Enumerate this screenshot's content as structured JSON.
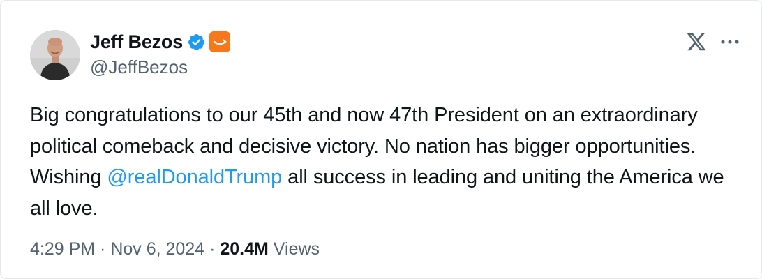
{
  "author": {
    "display_name": "Jeff Bezos",
    "handle": "@JeffBezos",
    "verified": true,
    "affiliate_badge": "amazon-smile-badge"
  },
  "tweet": {
    "text_before_mention": "Big congratulations to our 45th and now 47th President on an extraordinary political comeback and decisive victory. No nation has bigger opportunities. Wishing ",
    "mention": "@realDonaldTrump",
    "text_after_mention": " all success in leading and uniting the America we all love."
  },
  "meta": {
    "time": "4:29 PM",
    "separator1": " · ",
    "date": "Nov 6, 2024",
    "separator2": " · ",
    "views_count": "20.4M",
    "views_label": " Views"
  },
  "icons": {
    "verified": "verified-check-icon",
    "brand": "x-logo-icon",
    "more": "more-options-icon"
  },
  "colors": {
    "text": "#0f1419",
    "secondary": "#536471",
    "link": "#1d9bf0",
    "verified": "#1d9bf0",
    "badge": "#f7771b"
  }
}
